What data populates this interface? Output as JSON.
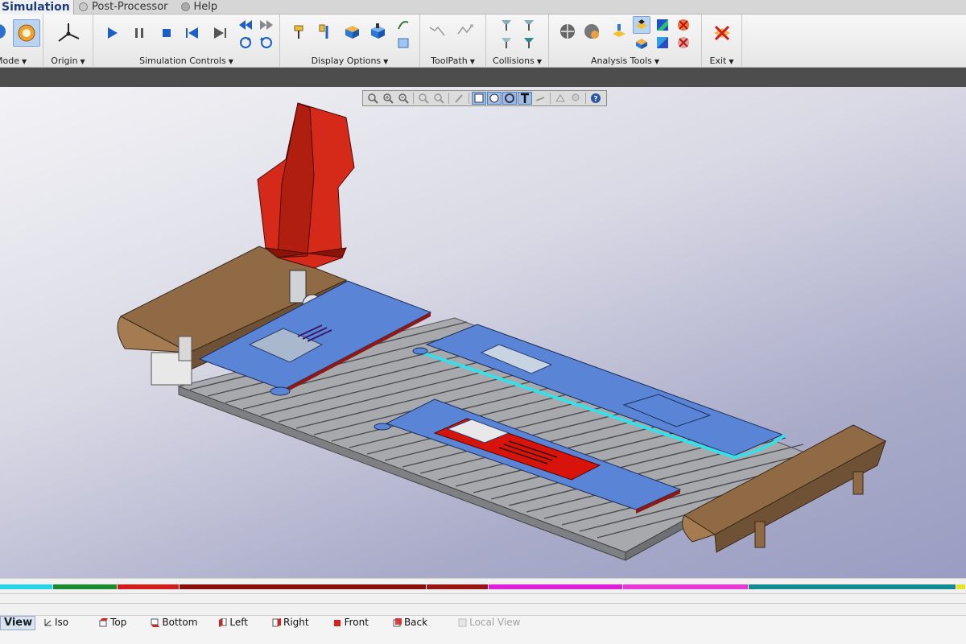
{
  "menubar": {
    "active_tab": "Simulation",
    "items": [
      "Post-Processor",
      "Help"
    ]
  },
  "ribbon": {
    "groups": {
      "mode": "Mode",
      "origin": "Origin",
      "simulation_controls": "Simulation Controls",
      "display_options": "Display Options",
      "toolpath": "ToolPath",
      "collisions": "Collisions",
      "analysis_tools": "Analysis Tools",
      "exit": "Exit"
    }
  },
  "viewbar": {
    "label": "View",
    "buttons": [
      "Iso",
      "Top",
      "Bottom",
      "Left",
      "Right",
      "Front",
      "Back",
      "Local View"
    ]
  },
  "colors": {
    "fixture_red": "#d52a1a",
    "part_blue": "#5a85d6",
    "toolpath_cyan": "#35e0e8",
    "rail_brown": "#8f6a45",
    "bed_gray": "#a7a9ad"
  },
  "timeline_segments": [
    {
      "color": "#27d3e8",
      "start": 0.0,
      "end": 0.055
    },
    {
      "color": "#1b8a2e",
      "start": 0.055,
      "end": 0.122
    },
    {
      "color": "#d21c1c",
      "start": 0.122,
      "end": 0.186
    },
    {
      "color": "#8a1010",
      "start": 0.186,
      "end": 0.442
    },
    {
      "color": "#9b1414",
      "start": 0.442,
      "end": 0.506
    },
    {
      "color": "#e01fd8",
      "start": 0.506,
      "end": 0.645
    },
    {
      "color": "#e63ad6",
      "start": 0.645,
      "end": 0.775
    },
    {
      "color": "#138a8f",
      "start": 0.775,
      "end": 0.99
    },
    {
      "color": "#e8e22a",
      "start": 0.99,
      "end": 1.0
    }
  ]
}
